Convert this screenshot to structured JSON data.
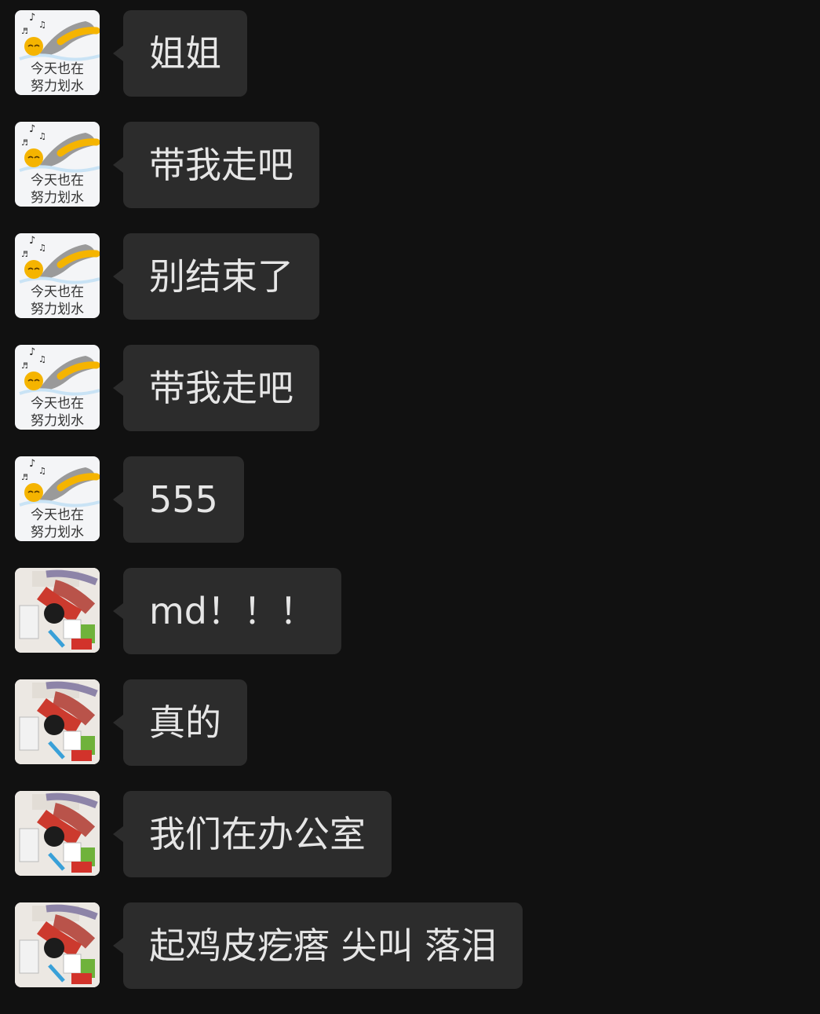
{
  "contact_a": {
    "avatar_caption_line1": "今天也在",
    "avatar_caption_line2": "努力划水"
  },
  "messages": [
    {
      "sender": "a",
      "text": "姐姐"
    },
    {
      "sender": "a",
      "text": "带我走吧"
    },
    {
      "sender": "a",
      "text": "别结束了"
    },
    {
      "sender": "a",
      "text": "带我走吧"
    },
    {
      "sender": "a",
      "text": "555"
    },
    {
      "sender": "b",
      "text": "md！！！"
    },
    {
      "sender": "b",
      "text": "真的"
    },
    {
      "sender": "b",
      "text": "我们在办公室"
    },
    {
      "sender": "b",
      "text": "起鸡皮疙瘩 尖叫 落泪"
    }
  ],
  "colors": {
    "background": "#111111",
    "bubble": "#2c2c2c",
    "text": "#e6e6e6"
  },
  "icons": {
    "avatar_a": "swimmer-emoji-avatar",
    "avatar_b": "photo-avatar"
  }
}
